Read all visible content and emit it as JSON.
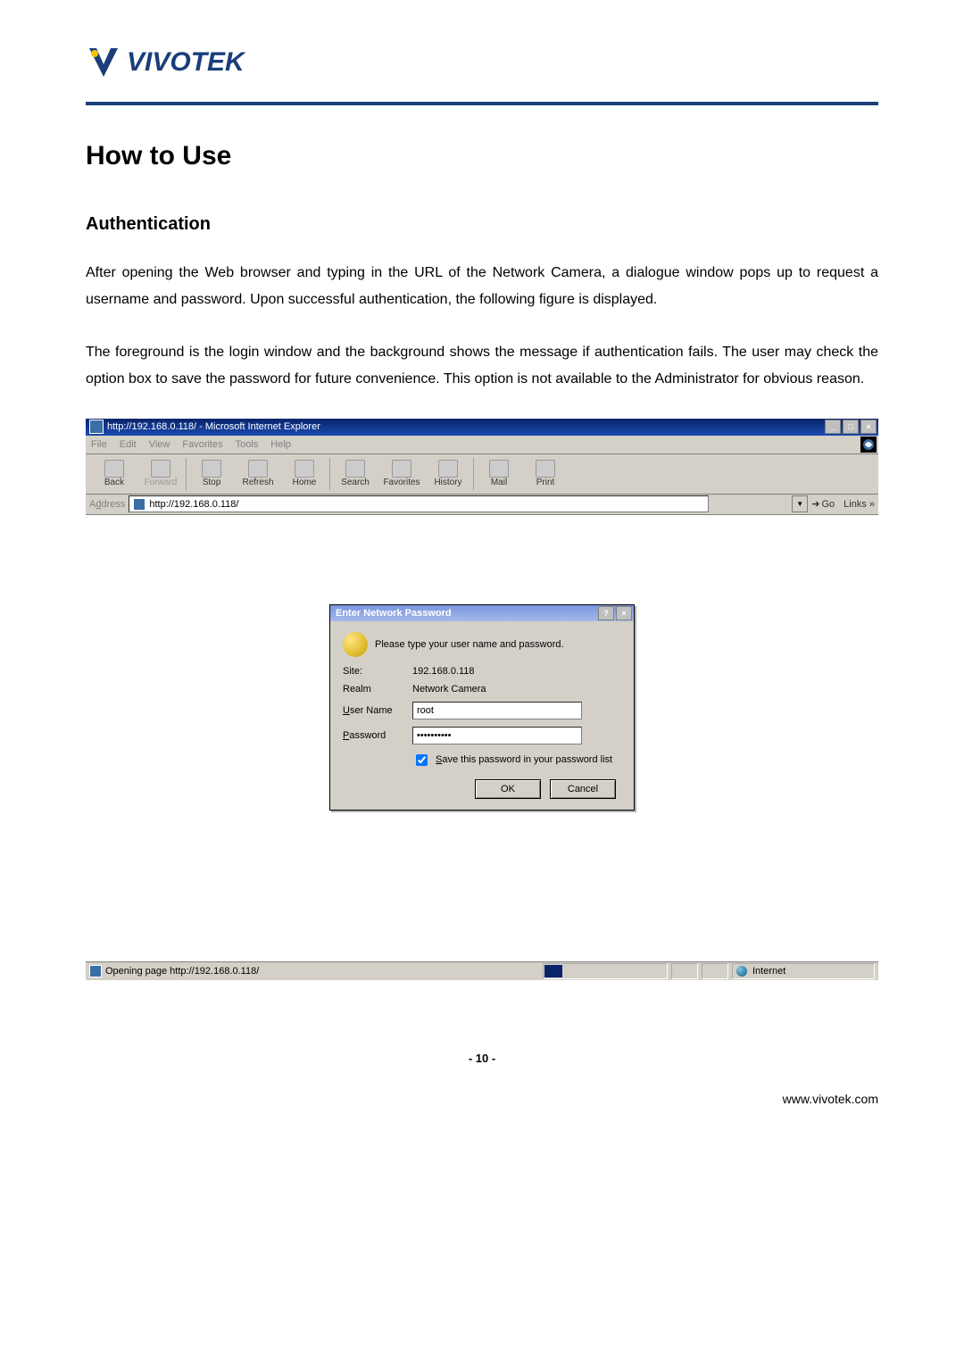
{
  "logo": {
    "text": "VIVOTEK"
  },
  "headings": {
    "h1": "How to Use",
    "h2": "Authentication"
  },
  "paragraphs": {
    "p1": "After opening the Web browser and typing in the URL of the Network Camera, a dialogue window pops up to request a username and password. Upon successful authentication, the following figure is displayed.",
    "p2": "The foreground is the login window and the background shows the message if authentication fails. The user may check the option box to save the password for future convenience.  This option is not available to the Administrator for obvious reason."
  },
  "ie": {
    "title": "http://192.168.0.118/ - Microsoft Internet Explorer",
    "menus": [
      "File",
      "Edit",
      "View",
      "Favorites",
      "Tools",
      "Help"
    ],
    "toolbar": {
      "back": "Back",
      "forward": "Forward",
      "stop": "Stop",
      "refresh": "Refresh",
      "home": "Home",
      "search": "Search",
      "favorites": "Favorites",
      "history": "History",
      "mail": "Mail",
      "print": "Print"
    },
    "address_label": "Address",
    "address_value": "http://192.168.0.118/",
    "go": "Go",
    "links": "Links »",
    "status_left": "Opening page http://192.168.0.118/",
    "status_zone": "Internet"
  },
  "dialog": {
    "title": "Enter Network Password",
    "prompt": "Please type your user name and password.",
    "site_label": "Site:",
    "site_value": "192.168.0.118",
    "realm_label": "Realm",
    "realm_value": "Network Camera",
    "user_label": "User Name",
    "user_value": "root",
    "pass_label": "Password",
    "pass_value": "••••••••••",
    "save_label": "Save this password in your password list",
    "ok": "OK",
    "cancel": "Cancel"
  },
  "footer": {
    "page": "- 10 -",
    "url": "www.vivotek.com"
  },
  "winbtns": {
    "min": "_",
    "max": "□",
    "close": "×"
  },
  "dlgbtns": {
    "help": "?",
    "close": "×"
  }
}
